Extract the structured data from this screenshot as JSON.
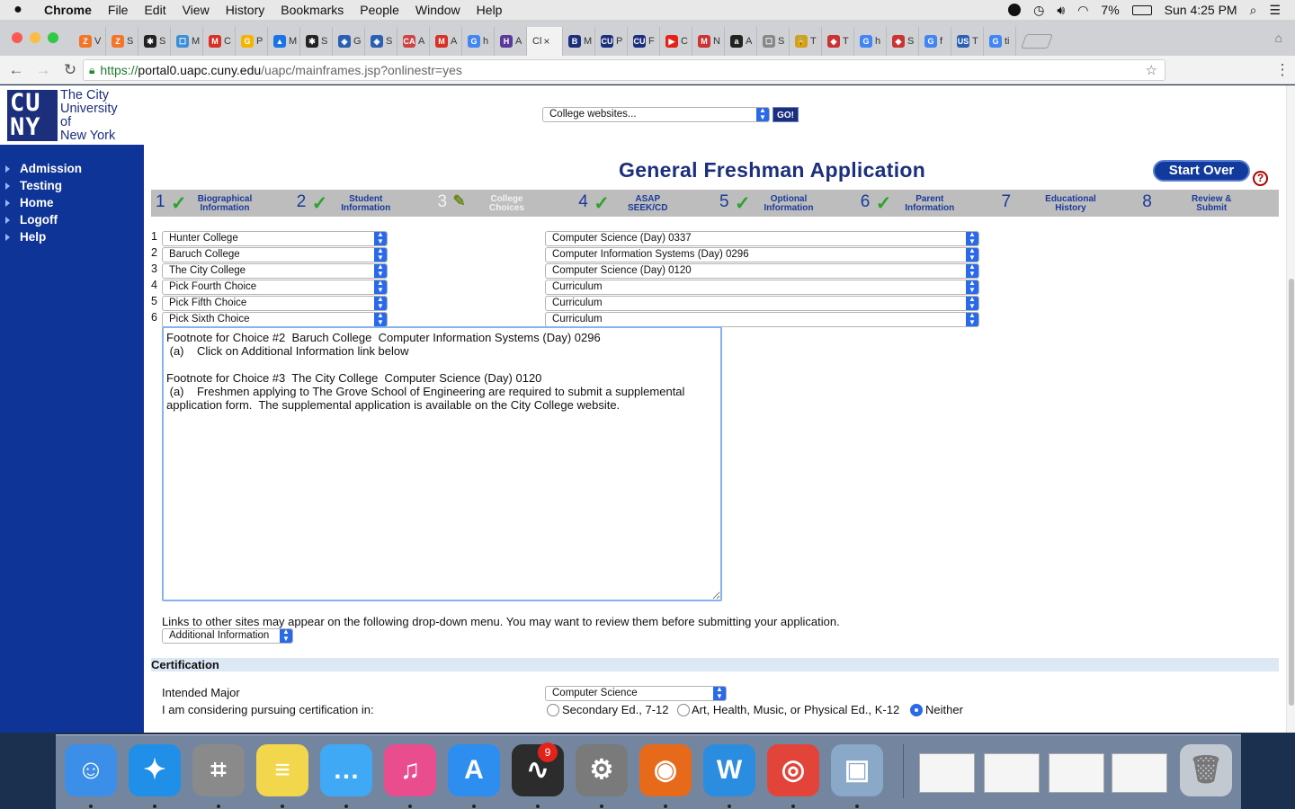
{
  "menubar": {
    "app": "Chrome",
    "items": [
      "File",
      "Edit",
      "View",
      "History",
      "Bookmarks",
      "People",
      "Window",
      "Help"
    ],
    "battery": "7%",
    "clock": "Sun 4:25 PM"
  },
  "browser": {
    "tabs": [
      {
        "letter": "V",
        "color": "#f3752a",
        "fav": "Z"
      },
      {
        "letter": "S",
        "color": "#f3752a",
        "fav": "Z"
      },
      {
        "letter": "S",
        "color": "#222",
        "fav": "✱"
      },
      {
        "letter": "M",
        "color": "#3b8fd9",
        "fav": "☐"
      },
      {
        "letter": "C",
        "color": "#d93025",
        "fav": "M"
      },
      {
        "letter": "P",
        "color": "#f5b400",
        "fav": "G"
      },
      {
        "letter": "M",
        "color": "#1a73e8",
        "fav": "▲"
      },
      {
        "letter": "S",
        "color": "#222",
        "fav": "✱"
      },
      {
        "letter": "G",
        "color": "#2b5fb4",
        "fav": "◈"
      },
      {
        "letter": "S",
        "color": "#2b5fb4",
        "fav": "◈"
      },
      {
        "letter": "A",
        "color": "#c44",
        "fav": "CA"
      },
      {
        "letter": "A",
        "color": "#d93025",
        "fav": "M"
      },
      {
        "letter": "h",
        "color": "#4285f4",
        "fav": "G"
      },
      {
        "letter": "A",
        "color": "#5a3a9a",
        "fav": "H"
      },
      {
        "letter": "Cl",
        "color": "#fff",
        "fav": "",
        "active": true
      },
      {
        "letter": "M",
        "color": "#1b2f7d",
        "fav": "B"
      },
      {
        "letter": "P",
        "color": "#1b2f7d",
        "fav": "CU"
      },
      {
        "letter": "F",
        "color": "#1b2f7d",
        "fav": "CU"
      },
      {
        "letter": "C",
        "color": "#e62117",
        "fav": "▶"
      },
      {
        "letter": "N",
        "color": "#c33",
        "fav": "M"
      },
      {
        "letter": "A",
        "color": "#222",
        "fav": "a"
      },
      {
        "letter": "S",
        "color": "#888",
        "fav": "☐"
      },
      {
        "letter": "T",
        "color": "#d4a017",
        "fav": "🔒"
      },
      {
        "letter": "T",
        "color": "#c33",
        "fav": "◆"
      },
      {
        "letter": "h",
        "color": "#4285f4",
        "fav": "G"
      },
      {
        "letter": "S",
        "color": "#c33",
        "fav": "◆"
      },
      {
        "letter": "f",
        "color": "#4285f4",
        "fav": "G"
      },
      {
        "letter": "T",
        "color": "#2b5fb4",
        "fav": "US"
      },
      {
        "letter": "ti",
        "color": "#4285f4",
        "fav": "G"
      }
    ],
    "url_scheme": "https://",
    "url_host": "portal0.uapc.cuny.edu",
    "url_path": "/uapc/mainframes.jsp?onlinestr=yes"
  },
  "logo": {
    "mark": "CU\nNY",
    "name_lines": [
      "The City",
      "University",
      "of",
      "New York"
    ]
  },
  "sidebar": {
    "items": [
      {
        "label": "Admission"
      },
      {
        "label": "Testing"
      },
      {
        "label": "Home"
      },
      {
        "label": "Logoff"
      },
      {
        "label": "Help"
      }
    ]
  },
  "college_select": {
    "value": "College websites...",
    "go_label": "GO!"
  },
  "header": {
    "title": "General Freshman Application",
    "start_over": "Start Over",
    "help": "?"
  },
  "steps": [
    {
      "num": "1",
      "label": "Biographical Information",
      "done": true
    },
    {
      "num": "2",
      "label": "Student Information",
      "done": true
    },
    {
      "num": "3",
      "label": "College Choices",
      "current": true
    },
    {
      "num": "4",
      "label": "ASAP SEEK/CD",
      "done": true
    },
    {
      "num": "5",
      "label": "Optional Information",
      "done": true
    },
    {
      "num": "6",
      "label": "Parent Information",
      "done": true
    },
    {
      "num": "7",
      "label": "Educational History"
    },
    {
      "num": "8",
      "label": "Review & Submit"
    }
  ],
  "choices": [
    {
      "num": "1",
      "college": "Hunter College",
      "program": "Computer Science (Day) 0337"
    },
    {
      "num": "2",
      "college": "Baruch College",
      "program": "Computer Information Systems (Day) 0296"
    },
    {
      "num": "3",
      "college": "The City College",
      "program": "Computer Science (Day) 0120"
    },
    {
      "num": "4",
      "college": "Pick Fourth Choice",
      "program": "Curriculum"
    },
    {
      "num": "5",
      "college": "Pick Fifth Choice",
      "program": "Curriculum"
    },
    {
      "num": "6",
      "college": "Pick Sixth Choice",
      "program": "Curriculum"
    }
  ],
  "footnotes": "Footnote for Choice #2  Baruch College  Computer Information Systems (Day) 0296\n (a)    Click on Additional Information link below\n\nFootnote for Choice #3  The City College  Computer Science (Day) 0120\n (a)    Freshmen applying to The Grove School of Engineering are required to submit a supplemental\napplication form.  The supplemental application is available on the City College website.",
  "links": {
    "note": "Links to other sites may appear on the following drop-down menu. You may want to review them before submitting your application.",
    "select": "Additional Information"
  },
  "certification": {
    "heading": "Certification",
    "major_label": "Intended Major",
    "major_value": "Computer Science",
    "pursuing_label": "I am considering pursuing certification in:",
    "options": [
      {
        "label": "Secondary Ed., 7-12",
        "selected": false
      },
      {
        "label": "Art, Health, Music, or Physical Ed., K-12",
        "selected": false
      },
      {
        "label": "Neither",
        "selected": true
      }
    ]
  },
  "dock": {
    "apps": [
      {
        "name": "finder-icon",
        "glyph": "☺",
        "color": "#3b8fe8"
      },
      {
        "name": "safari-icon",
        "glyph": "✦",
        "color": "#1f8fe8"
      },
      {
        "name": "calculator-icon",
        "glyph": "⌗",
        "color": "#8a8a8a"
      },
      {
        "name": "notes-icon",
        "glyph": "≡",
        "color": "#f2d64b"
      },
      {
        "name": "messages-icon",
        "glyph": "…",
        "color": "#3fa9f5"
      },
      {
        "name": "itunes-icon",
        "glyph": "♫",
        "color": "#e94d8e"
      },
      {
        "name": "app-store-icon",
        "glyph": "A",
        "color": "#2d8ef0"
      },
      {
        "name": "activity-monitor-icon",
        "glyph": "∿",
        "color": "#2c2c2c"
      },
      {
        "name": "system-preferences-icon",
        "glyph": "⚙",
        "color": "#7a7a7a"
      },
      {
        "name": "firefox-icon",
        "glyph": "◉",
        "color": "#e66a1a"
      },
      {
        "name": "word-icon",
        "glyph": "W",
        "color": "#2b8de0"
      },
      {
        "name": "chrome-icon",
        "glyph": "◎",
        "color": "#e2443a"
      },
      {
        "name": "preview-icon",
        "glyph": "▣",
        "color": "#8aa8c8"
      }
    ],
    "badge": "9"
  }
}
